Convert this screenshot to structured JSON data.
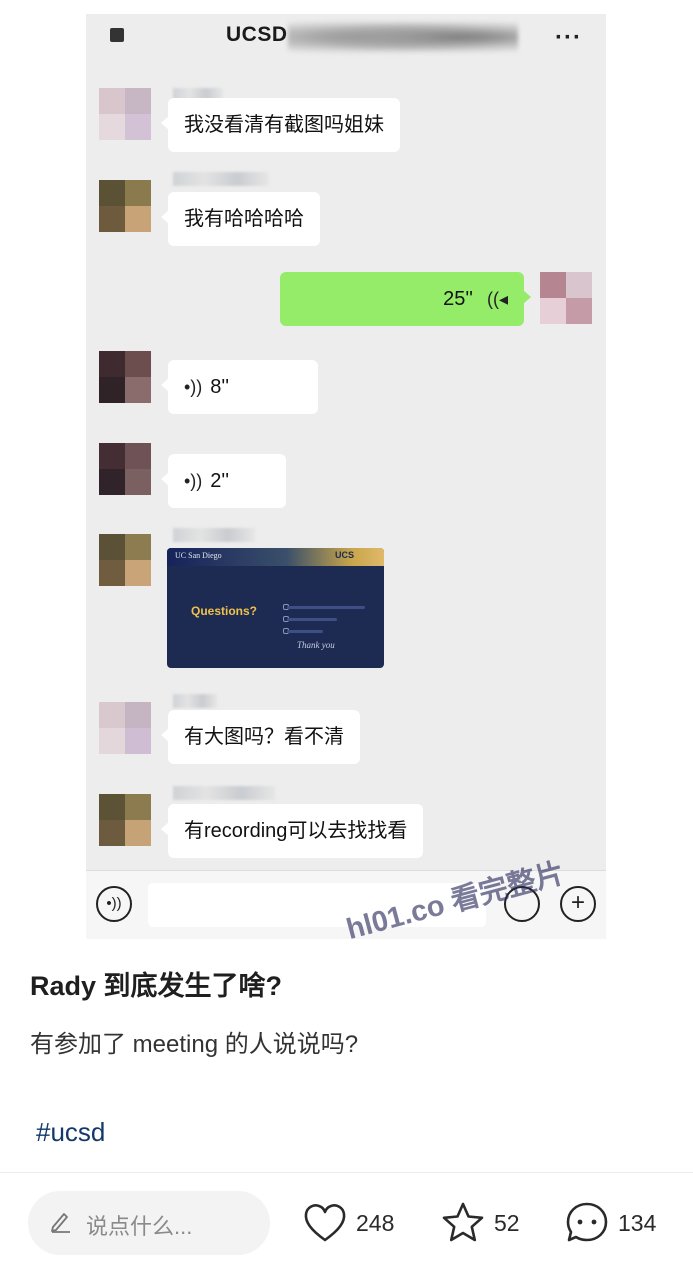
{
  "chat": {
    "title": "UCSD",
    "messages": [
      {
        "side": "left",
        "text": "我没看清有截图吗姐妹"
      },
      {
        "side": "left",
        "text": "我有哈哈哈哈"
      },
      {
        "side": "right",
        "type": "voice",
        "duration": "25''"
      },
      {
        "side": "left",
        "type": "voice",
        "duration": "8''"
      },
      {
        "side": "left",
        "type": "voice",
        "duration": "2''"
      },
      {
        "side": "left",
        "type": "image",
        "slide": {
          "logo": "UC San Diego",
          "mark": "UCS",
          "heading": "Questions?",
          "thanks": "Thank you"
        }
      },
      {
        "side": "left",
        "text": "有大图吗？看不清"
      },
      {
        "side": "left",
        "text": "有recording可以去找找看"
      }
    ],
    "icons": {
      "back": "back-icon",
      "more": "more-icon",
      "voice": "voice-icon",
      "emoji": "emoji-icon",
      "plus": "plus-icon"
    },
    "more_glyph": "···",
    "plus_glyph": "+"
  },
  "watermark": "hl01.co 看完整片",
  "post": {
    "title": "Rady 到底发生了啥?",
    "body": "有参加了 meeting 的人说说吗?",
    "tag": "#ucsd"
  },
  "actions": {
    "comment_placeholder": "说点什么...",
    "likes": "248",
    "favorites": "52",
    "comments": "134",
    "icons": [
      "heart-icon",
      "star-icon",
      "comment-icon",
      "pencil-icon"
    ]
  },
  "colors": {
    "chat_bg": "#ededed",
    "green_bubble": "#95ec69",
    "tag_color": "#13386c",
    "slide_bg": "#1d2a52",
    "slide_heading": "#f0c24a"
  }
}
